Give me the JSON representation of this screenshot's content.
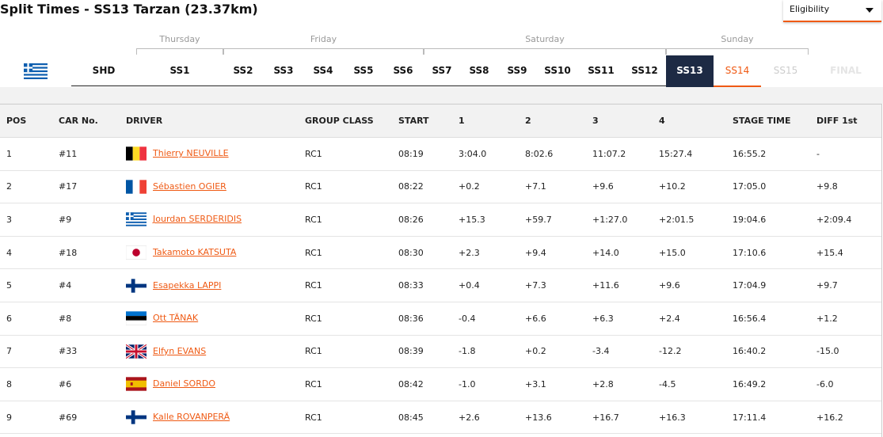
{
  "page_title": "Split Times - SS13 Tarzan (23.37km)",
  "eligibility": {
    "label": "Eligibility"
  },
  "days": [
    "Thursday",
    "Friday",
    "Saturday",
    "Sunday"
  ],
  "stages": [
    "SHD",
    "SS1",
    "SS2",
    "SS3",
    "SS4",
    "SS5",
    "SS6",
    "SS7",
    "SS8",
    "SS9",
    "SS10",
    "SS11",
    "SS12",
    "SS13",
    "SS14",
    "SS15",
    "FINAL"
  ],
  "active_stage": "SS13",
  "next_stage": "SS14",
  "colors": {
    "accent": "#ef5a14",
    "active": "#1d2a44",
    "slower": "#d11111",
    "faster": "#1a8a1a"
  },
  "table": {
    "headers": [
      "POS",
      "CAR No.",
      "DRIVER",
      "GROUP CLASS",
      "START",
      "1",
      "2",
      "3",
      "4",
      "STAGE TIME",
      "DIFF 1st"
    ],
    "rows": [
      {
        "pos": "1",
        "car": "#11",
        "flag": "be",
        "driver": "Thierry NEUVILLE",
        "group": "RC1",
        "start": "08:19",
        "s1": "3:04.0",
        "s2": "8:02.6",
        "s3": "11:07.2",
        "s4": "15:27.4",
        "stage": "16:55.2",
        "diff": "-"
      },
      {
        "pos": "2",
        "car": "#17",
        "flag": "fr",
        "driver": "Sébastien OGIER",
        "group": "RC1",
        "start": "08:22",
        "s1": "+0.2",
        "s2": "+7.1",
        "s3": "+9.6",
        "s4": "+10.2",
        "stage": "17:05.0",
        "diff": "+9.8"
      },
      {
        "pos": "3",
        "car": "#9",
        "flag": "gr",
        "driver": "Jourdan SERDERIDIS",
        "group": "RC1",
        "start": "08:26",
        "s1": "+15.3",
        "s2": "+59.7",
        "s3": "+1:27.0",
        "s4": "+2:01.5",
        "stage": "19:04.6",
        "diff": "+2:09.4"
      },
      {
        "pos": "4",
        "car": "#18",
        "flag": "jp",
        "driver": "Takamoto KATSUTA",
        "group": "RC1",
        "start": "08:30",
        "s1": "+2.3",
        "s2": "+9.4",
        "s3": "+14.0",
        "s4": "+15.0",
        "stage": "17:10.6",
        "diff": "+15.4"
      },
      {
        "pos": "5",
        "car": "#4",
        "flag": "fi",
        "driver": "Esapekka LAPPI",
        "group": "RC1",
        "start": "08:33",
        "s1": "+0.4",
        "s2": "+7.3",
        "s3": "+11.6",
        "s4": "+9.6",
        "stage": "17:04.9",
        "diff": "+9.7"
      },
      {
        "pos": "6",
        "car": "#8",
        "flag": "ee",
        "driver": "Ott TÄNAK",
        "group": "RC1",
        "start": "08:36",
        "s1": "-0.4",
        "s2": "+6.6",
        "s3": "+6.3",
        "s4": "+2.4",
        "stage": "16:56.4",
        "diff": "+1.2"
      },
      {
        "pos": "7",
        "car": "#33",
        "flag": "gb",
        "driver": "Elfyn EVANS",
        "group": "RC1",
        "start": "08:39",
        "s1": "-1.8",
        "s2": "+0.2",
        "s3": "-3.4",
        "s4": "-12.2",
        "stage": "16:40.2",
        "diff": "-15.0"
      },
      {
        "pos": "8",
        "car": "#6",
        "flag": "es",
        "driver": "Daniel SORDO",
        "group": "RC1",
        "start": "08:42",
        "s1": "-1.0",
        "s2": "+3.1",
        "s3": "+2.8",
        "s4": "-4.5",
        "stage": "16:49.2",
        "diff": "-6.0"
      },
      {
        "pos": "9",
        "car": "#69",
        "flag": "fi",
        "driver": "Kalle ROVANPERÄ",
        "group": "RC1",
        "start": "08:45",
        "s1": "+2.6",
        "s2": "+13.6",
        "s3": "+16.7",
        "s4": "+16.3",
        "stage": "17:11.4",
        "diff": "+16.2"
      }
    ],
    "row7_green_cols": [
      "s1",
      "s2",
      "s3",
      "s4",
      "stage",
      "diff"
    ],
    "row8_green_cols": [
      "diff"
    ]
  }
}
